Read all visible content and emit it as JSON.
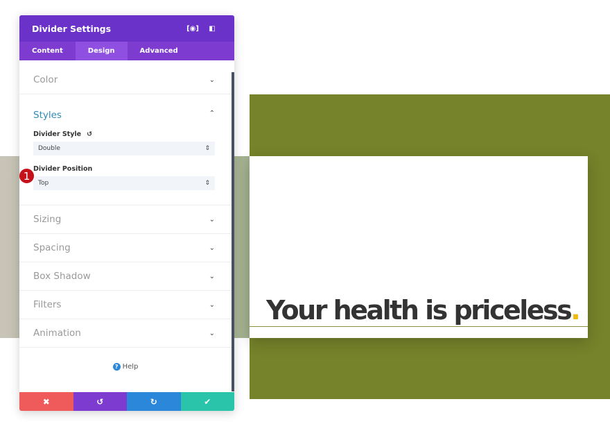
{
  "panel": {
    "title": "Divider Settings",
    "tabs": [
      "Content",
      "Design",
      "Advanced"
    ],
    "active_tab": "Design",
    "sections_before": [
      {
        "label": "Color"
      }
    ],
    "styles": {
      "label": "Styles",
      "divider_style_label": "Divider Style",
      "divider_style_value": "Double",
      "divider_position_label": "Divider Position",
      "divider_position_value": "Top"
    },
    "sections_after": [
      {
        "label": "Sizing"
      },
      {
        "label": "Spacing"
      },
      {
        "label": "Box Shadow"
      },
      {
        "label": "Filters"
      },
      {
        "label": "Animation"
      }
    ],
    "help": "Help",
    "marker": "1"
  },
  "preview": {
    "headline": "Your health is priceless",
    "dot": ".",
    "colors": {
      "olive": "#76832a",
      "accent": "#f0b90b"
    }
  },
  "colors": {
    "header": "#6a32c9",
    "cancel": "#ef5a5a",
    "undo": "#7e3bd0",
    "redo": "#2b87da",
    "save": "#29c4a9"
  }
}
